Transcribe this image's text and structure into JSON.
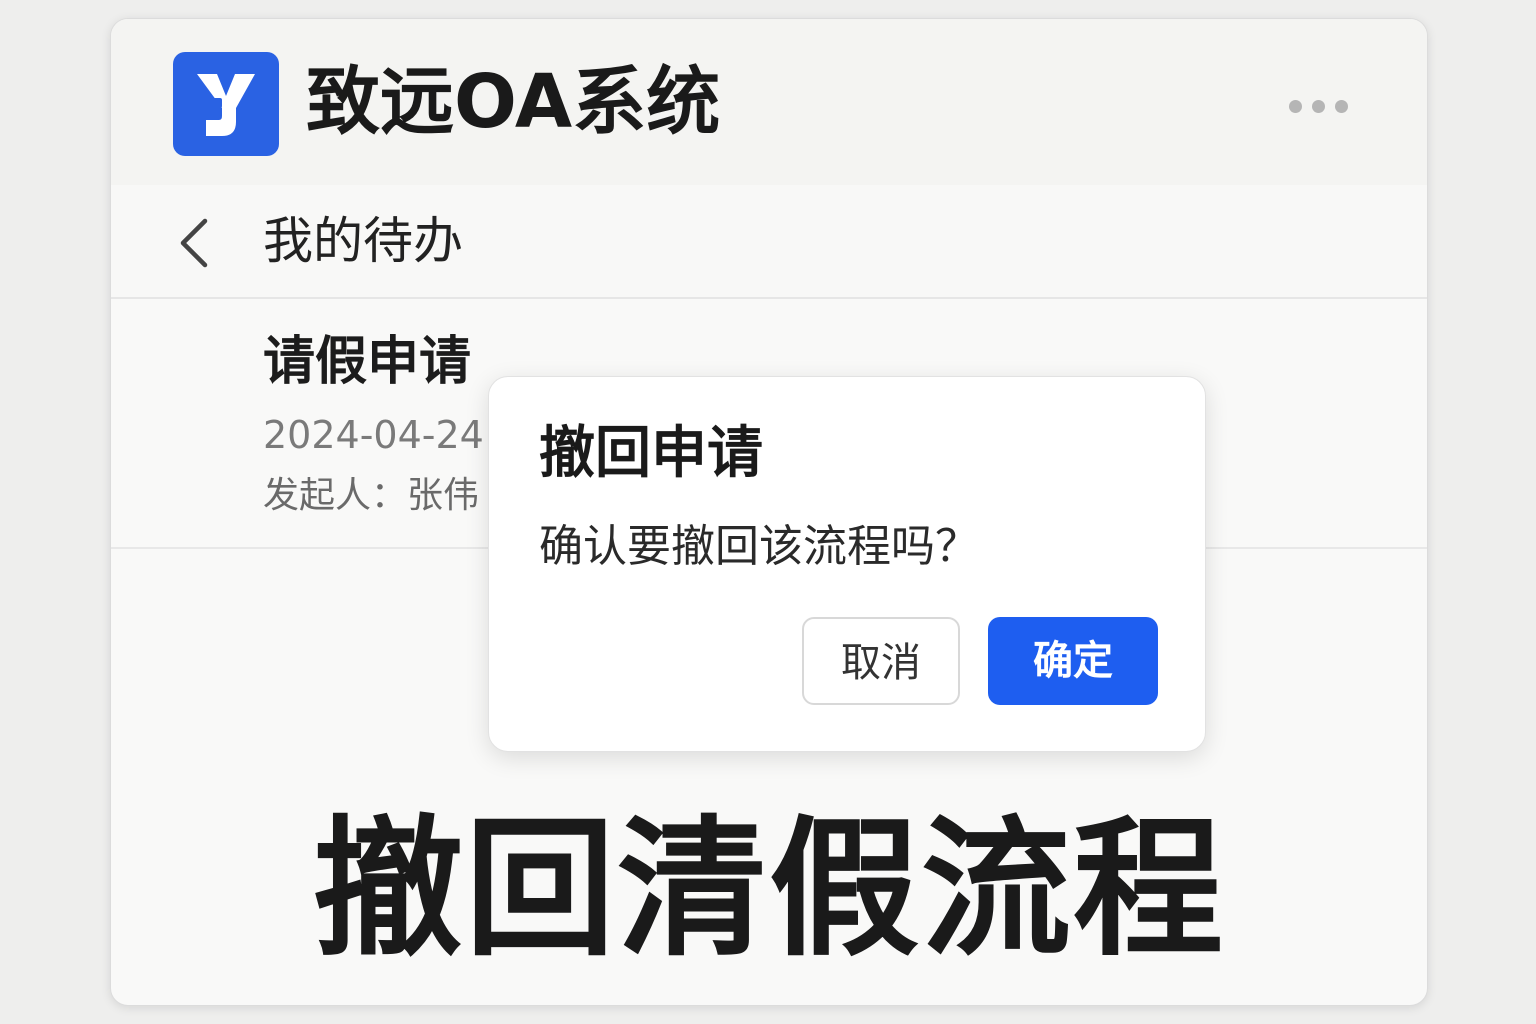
{
  "app": {
    "title": "致远OA系统",
    "logo_icon": "yonyou-logo-icon",
    "brand_color": "#2a62e3",
    "menu_icon": "more-dots-icon"
  },
  "nav": {
    "back_icon": "chevron-left-icon",
    "title": "我的待办"
  },
  "todo_item": {
    "title": "请假申请",
    "date": "2024-04-24",
    "initiator": "发起人：张伟"
  },
  "dialog": {
    "title": "撤回申请",
    "message": "确认要撤回该流程吗？",
    "cancel_label": "取消",
    "confirm_label": "确定",
    "confirm_color": "#1e5ef0"
  },
  "caption": {
    "text": "撤回清假流程"
  }
}
